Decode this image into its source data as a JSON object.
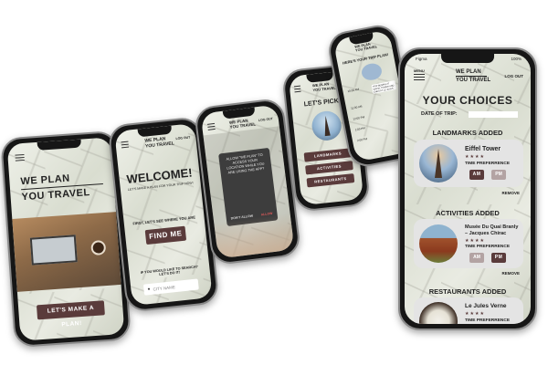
{
  "brand": {
    "line1": "WE PLAN",
    "line2": "YOU TRAVEL",
    "menu": "MENU",
    "logout": "LOG OUT"
  },
  "phone1": {
    "cta": "LET'S MAKE A PLAN!"
  },
  "phone2": {
    "title": "WELCOME!",
    "subtitle": "LET'S MAKE A PLAN FOR YOUR TRIP NOW!",
    "first": "FIRST, LET'S SEE WHERE YOU ARE",
    "find_me": "FIND ME",
    "search_prompt": "IF YOU WOULD LIKE TO SEARCH? LET'S DO IT!",
    "city_placeholder": "CITY NAME"
  },
  "phone3": {
    "dialog_text": "ALLOW \"WE PLAN\" TO ACCESS YOUR LOCATION WHILE YOU ARE USING THE APP?",
    "dont_allow": "DON'T ALLOW",
    "allow": "ALLOW"
  },
  "phone4": {
    "title": "LET'S PICK!",
    "buttons": [
      "LANDMARKS",
      "ACTIVITIES",
      "RESTAURANTS"
    ]
  },
  "phone5": {
    "title": "HERE'S YOUR TRIP PLAN!",
    "times": [
      "10:00 AM",
      "11:00 AM",
      "12:00 PM",
      "1:00 PM",
      "2:00 PM"
    ],
    "stop_text": "TRIP BEGINS AT EIFFEL TOWER AND ENDS AT LE JULES VERNE"
  },
  "phone6": {
    "status_carrier": "Figma",
    "status_battery": "100%",
    "title": "YOUR CHOICES",
    "date_label": "DATE OF TRIP:",
    "landmarks_heading": "LANDMARKS ADDED",
    "activities_heading": "ACTIVITIES ADDED",
    "restaurants_heading": "RESTAURANTS ADDED",
    "items": [
      {
        "name": "Eiffel Tower",
        "stars": "★★★★",
        "pref": "TIME PREFERRENCE",
        "am": "AM",
        "pm": "PM",
        "remove": "REMOVE"
      },
      {
        "name": "Musée Du Quai Branly – Jacques Chirac",
        "stars": "★★★★",
        "pref": "TIME PREFERRENCE",
        "am": "AM",
        "pm": "PM",
        "remove": "REMOVE"
      },
      {
        "name": "Le Jules Verne",
        "stars": "★★★★",
        "pref": "TIME PREFERRENCE"
      }
    ]
  },
  "colors": {
    "accent": "#5a3b3b",
    "phone_frame": "#161616",
    "card_bg": "#e4e4e4"
  }
}
